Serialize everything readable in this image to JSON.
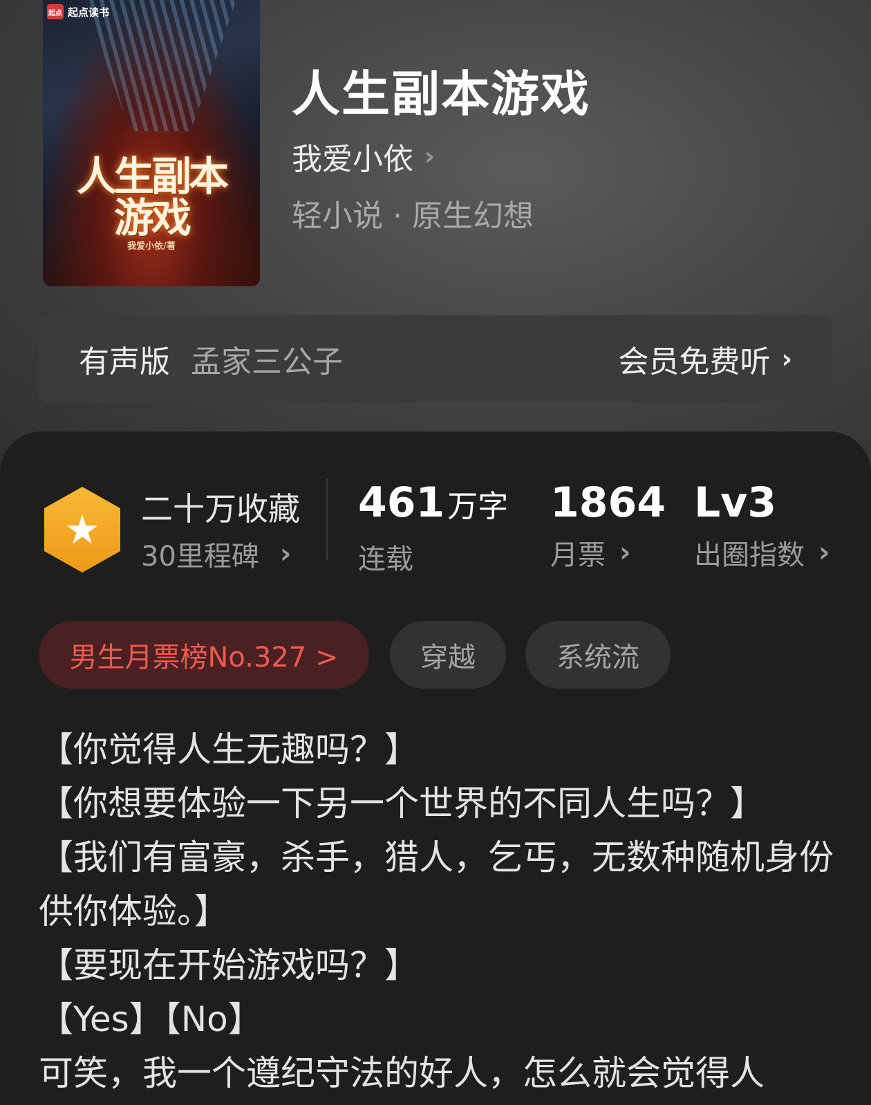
{
  "cover": {
    "badge": "起点读书",
    "badge_logo": "起点",
    "title_line1": "人生副本",
    "title_line2": "游戏",
    "author_credit": "我爱小依/著"
  },
  "book": {
    "title": "人生副本游戏",
    "author": "我爱小依",
    "genre": "轻小说 · 原生幻想"
  },
  "audio": {
    "label": "有声版",
    "narrator": "孟家三公子",
    "action": "会员免费听"
  },
  "stats": {
    "favorites_main": "二十万收藏",
    "favorites_sub": "30里程碑",
    "words_value": "461",
    "words_unit": "万字",
    "words_label": "连载",
    "tickets_value": "1864",
    "tickets_label": "月票",
    "level_value": "Lv3",
    "level_label": "出圈指数"
  },
  "tags": {
    "rank": "男生月票榜No.327 >",
    "tag1": "穿越",
    "tag2": "系统流"
  },
  "synopsis": [
    "【你觉得人生无趣吗？】",
    "【你想要体验一下另一个世界的不同人生吗？】",
    "【我们有富豪，杀手，猎人，乞丐，无数种随机身份供你体验。】",
    "【要现在开始游戏吗？】",
    "【Yes】【No】",
    "可笑，我一个遵纪守法的好人，怎么就会觉得人"
  ],
  "colors": {
    "accent_red": "#f05a4f",
    "star_badge": "#f7b834"
  }
}
